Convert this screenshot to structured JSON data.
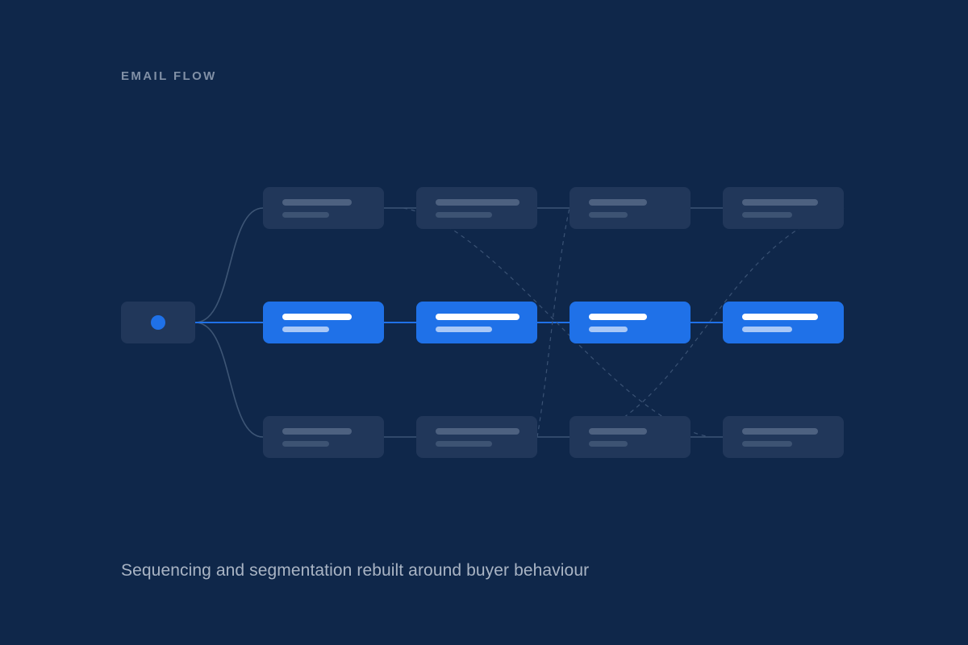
{
  "eyebrow": "EMAIL FLOW",
  "caption": "Sequencing and segmentation rebuilt around buyer behaviour",
  "colors": {
    "background": "#0f274a",
    "accent": "#1f71e8",
    "node_muted": "#21375a",
    "bar_muted_primary": "#4d6180",
    "bar_muted_secondary": "#3d5373",
    "bar_active_primary": "#ffffff",
    "bar_active_secondary": "#a9c8f7",
    "connector_muted": "#3d5575",
    "connector_dashed": "#3a5274"
  },
  "flow": {
    "start_node": {
      "icon": "dot-icon"
    },
    "lanes": [
      {
        "id": "top",
        "active": false,
        "steps": 4
      },
      {
        "id": "middle",
        "active": true,
        "steps": 4
      },
      {
        "id": "bottom",
        "active": false,
        "steps": 4
      }
    ]
  }
}
